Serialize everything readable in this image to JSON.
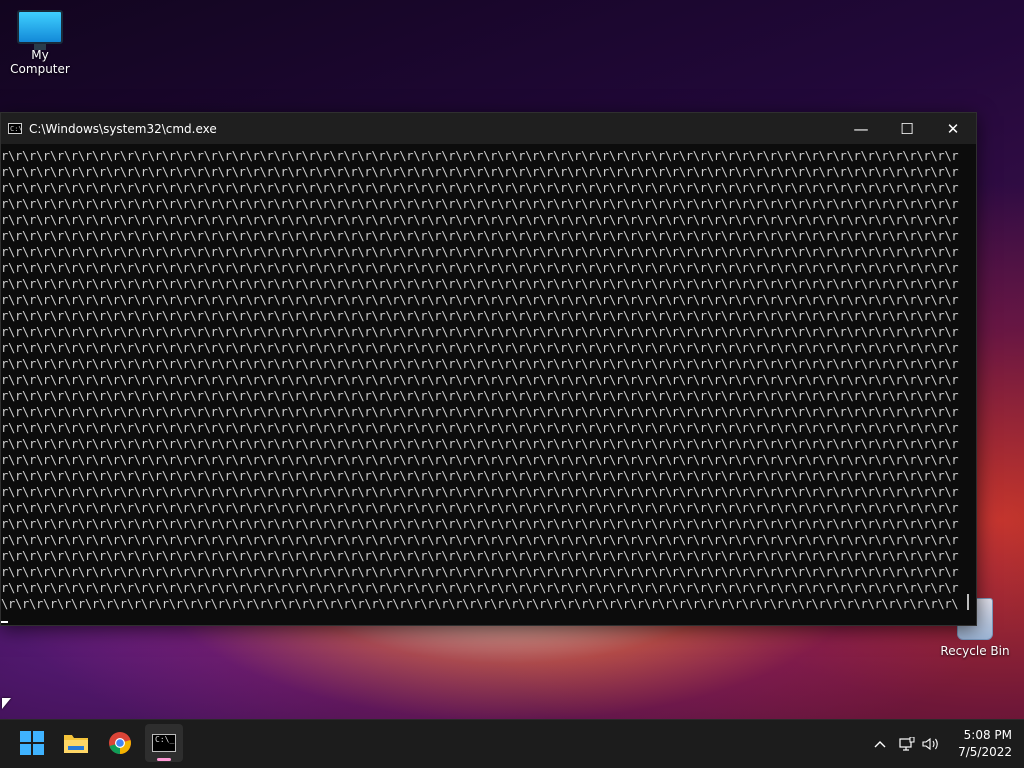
{
  "desktop": {
    "icons": [
      {
        "label": "My Computer"
      },
      {
        "label": "Recycle Bin"
      }
    ]
  },
  "cmd_window": {
    "title": "C:\\Windows\\system32\\cmd.exe",
    "buttons": {
      "minimize": "—",
      "maximize": "☐",
      "close": "✕"
    },
    "terminal": {
      "repeated_line": "r\\r\\r\\r\\r\\r\\r\\r\\r\\r\\r\\r\\r\\r\\r\\r\\r\\r\\r\\r\\r\\r\\r\\r\\r\\r\\r\\r\\r\\r\\r\\r\\r\\r\\r\\r\\r\\r\\r\\r\\r\\r\\r\\r\\r\\r\\r\\r\\r\\r\\r\\r\\r\\r\\r\\r\\r\\r\\r\\r\\r\\r\\r\\r\\r\\r\\r\\r\\r\\r\\r\\r\\r\\r\\r\\r\\r\\r\\r\\r\\r\\r\\r\\r\\r\\r\\r\\r\\r\\r\\r\\r\\r\\r\\r\\r\\r\\r\\r\\r",
      "repeated_count": 28,
      "last_line": "\\r\\r\\r\\r\\r\\r\\r\\r\\r\\r\\r\\r\\r\\r\\r\\r\\r\\r\\r\\r\\r\\r\\r\\r\\r\\r\\r\\r\\r\\r\\r\\r\\r\\r\\r\\r\\r\\r\\r\\r\\r\\r\\r\\r\\r\\r\\r\\r\\r\\r\\r\\r\\r\\r\\r\\r\\r\\r\\r\\r\\r\\r\\r\\r\\r\\r\\r\\r\\r\\r\\r\\r\\r\\r\\r\\r\\r\\r\\r\\r\\r\\r\\r\\r\\r\\r\\r\\r\\r\\r\\r\\r\\r\\r\\r\\r\\r\\r\\r\\r>cd r"
    }
  },
  "taskbar": {
    "apps": [
      {
        "name": "Start",
        "icon": "windows-logo-icon"
      },
      {
        "name": "File Explorer",
        "icon": "folder-icon"
      },
      {
        "name": "Google Chrome",
        "icon": "chrome-icon"
      },
      {
        "name": "Command Prompt",
        "icon": "cmd-icon",
        "active": true
      }
    ],
    "tray": {
      "overflow_icon": "chevron-up-icon",
      "network_icon": "network-icon",
      "volume_icon": "volume-icon"
    },
    "clock": {
      "time": "5:08 PM",
      "date": "7/5/2022"
    }
  }
}
